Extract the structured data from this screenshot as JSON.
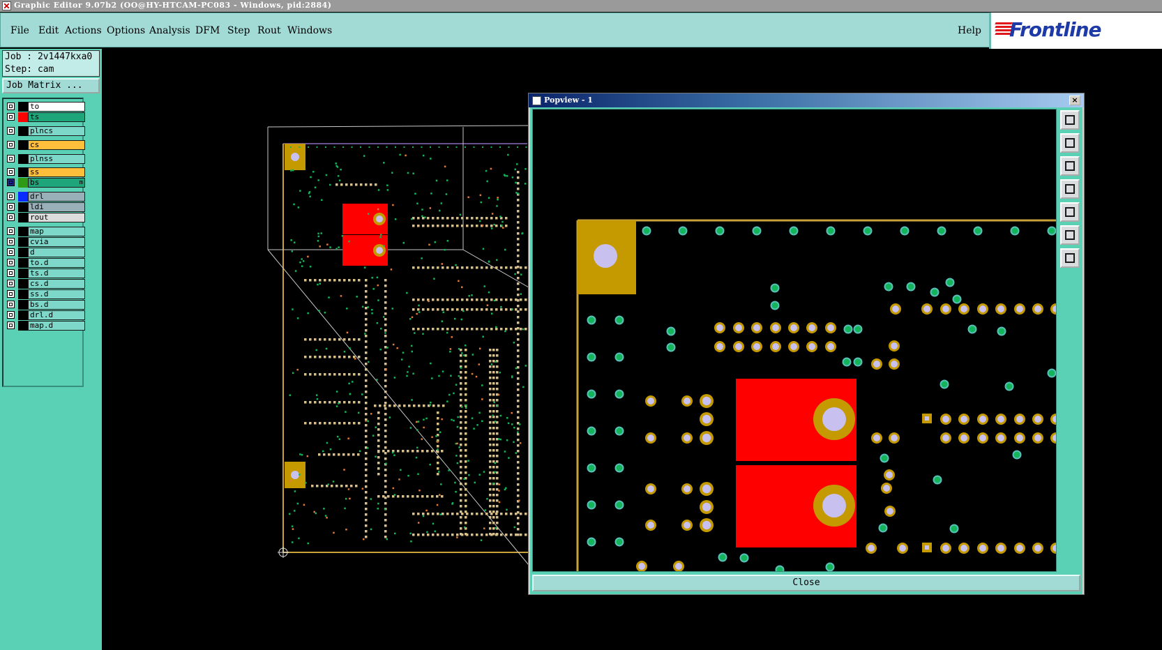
{
  "window": {
    "title": "Graphic Editor 9.07b2 (OO@HY-HTCAM-PC083 - Windows, pid:2884)"
  },
  "menu": {
    "items": [
      "File",
      "Edit",
      "Actions",
      "Options",
      "Analysis",
      "DFM",
      "Step",
      "Rout",
      "Windows"
    ],
    "help": "Help"
  },
  "brand": {
    "name": "Frontline",
    "color": "#1e3aa6",
    "stripe_color": "#e0181c"
  },
  "job": {
    "job_label": "Job : 2v1447kxa0",
    "step_label": "Step: cam",
    "matrix_button": "Job Matrix ..."
  },
  "layers": [
    {
      "name": "to",
      "color": "#ffffff",
      "swatch": "#000000"
    },
    {
      "name": "ts",
      "color": "#1fa57a",
      "swatch": "#ff0000"
    },
    {
      "name": "plncs",
      "color": "#7ed8c9",
      "swatch": "#000000"
    },
    {
      "name": "cs",
      "color": "#ffbf3a",
      "swatch": "#000000"
    },
    {
      "name": "plnss",
      "color": "#7ed8c9",
      "swatch": "#000000"
    },
    {
      "name": "ss",
      "color": "#ffbf3a",
      "swatch": "#000000"
    },
    {
      "name": "bs",
      "color": "#1fa57a",
      "swatch": "#2e9a16",
      "extra": "m"
    },
    {
      "name": "drl",
      "color": "#9ab0b8",
      "swatch": "#0a2bff"
    },
    {
      "name": "ldi",
      "color": "#9ab0b8",
      "swatch": "#000000"
    },
    {
      "name": "rout",
      "color": "#dcdcdc",
      "swatch": "#000000"
    },
    {
      "name": "map",
      "color": "#7ed8c9",
      "swatch": "#000000"
    },
    {
      "name": "cvia",
      "color": "#7ed8c9",
      "swatch": "#000000"
    },
    {
      "name": "d",
      "color": "#7ed8c9",
      "swatch": "#000000"
    },
    {
      "name": "to.d",
      "color": "#7ed8c9",
      "swatch": "#000000"
    },
    {
      "name": "ts.d",
      "color": "#7ed8c9",
      "swatch": "#000000"
    },
    {
      "name": "cs.d",
      "color": "#7ed8c9",
      "swatch": "#000000"
    },
    {
      "name": "ss.d",
      "color": "#7ed8c9",
      "swatch": "#000000"
    },
    {
      "name": "bs.d",
      "color": "#7ed8c9",
      "swatch": "#000000"
    },
    {
      "name": "drl.d",
      "color": "#7ed8c9",
      "swatch": "#000000"
    },
    {
      "name": "map.d",
      "color": "#7ed8c9",
      "swatch": "#000000"
    }
  ],
  "popview": {
    "title": "Popview - 1",
    "close_x": "×",
    "close_button": "Close",
    "toolbar_icons": [
      "zoom-home-icon",
      "pan-up-icon",
      "pan-down-icon",
      "pan-left-icon",
      "pan-right-icon",
      "zoom-fit-icon",
      "zoom-center-icon"
    ]
  },
  "colors": {
    "pad_gold": "#c49a00",
    "pad_red": "#ff0000",
    "drill": "#c8c0ee",
    "via_green": "#14b45a",
    "via_teal": "#58c0b8",
    "panel": "#5ad0b4"
  }
}
